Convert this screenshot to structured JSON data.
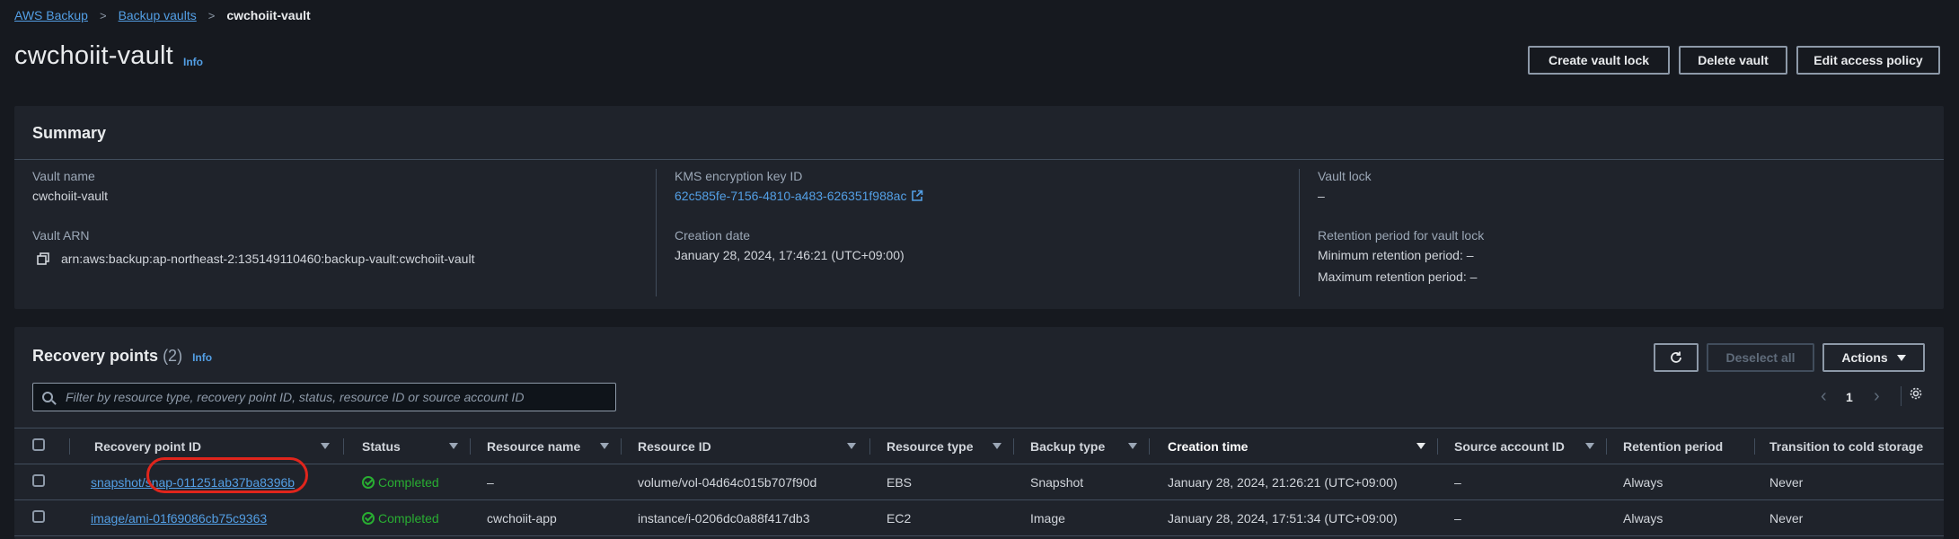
{
  "breadcrumb": [
    "AWS Backup",
    "Backup vaults",
    "cwchoiit-vault"
  ],
  "header": {
    "title": "cwchoiit-vault",
    "info": "Info",
    "buttons": {
      "create_lock": "Create vault lock",
      "delete": "Delete vault",
      "edit_policy": "Edit access policy"
    }
  },
  "summary": {
    "title": "Summary",
    "vault_name_label": "Vault name",
    "vault_name": "cwchoiit-vault",
    "vault_arn_label": "Vault ARN",
    "vault_arn": "arn:aws:backup:ap-northeast-2:135149110460:backup-vault:cwchoiit-vault",
    "kms_label": "KMS encryption key ID",
    "kms_value": "62c585fe-7156-4810-a483-626351f988ac",
    "creation_label": "Creation date",
    "creation_value": "January 28, 2024, 17:46:21 (UTC+09:00)",
    "lock_label": "Vault lock",
    "lock_value": "–",
    "retention_label": "Retention period for vault lock",
    "min_retention": "Minimum retention period: –",
    "max_retention": "Maximum retention period: –"
  },
  "recovery": {
    "title": "Recovery points",
    "count": "(2)",
    "info": "Info",
    "deselect": "Deselect all",
    "actions": "Actions",
    "search_placeholder": "Filter by resource type, recovery point ID, status, resource ID or source account ID",
    "page": "1",
    "columns": [
      "Recovery point ID",
      "Status",
      "Resource name",
      "Resource ID",
      "Resource type",
      "Backup type",
      "Creation time",
      "Source account ID",
      "Retention period",
      "Transition to cold storage"
    ],
    "rows": [
      {
        "id": "snapshot/snap-011251ab37ba8396b",
        "status": "Completed",
        "resource_name": "–",
        "resource_id": "volume/vol-04d64c015b707f90d",
        "resource_type": "EBS",
        "backup_type": "Snapshot",
        "creation_time": "January 28, 2024, 21:26:21 (UTC+09:00)",
        "source_account": "–",
        "retention": "Always",
        "cold": "Never"
      },
      {
        "id": "image/ami-01f69086cb75c9363",
        "status": "Completed",
        "resource_name": "cwchoiit-app",
        "resource_id": "instance/i-0206dc0a88f417db3",
        "resource_type": "EC2",
        "backup_type": "Image",
        "creation_time": "January 28, 2024, 17:51:34 (UTC+09:00)",
        "source_account": "–",
        "retention": "Always",
        "cold": "Never"
      }
    ]
  },
  "colors": {
    "background": "#16191f",
    "panel": "#1f232b",
    "link": "#539fe5",
    "success": "#29ad32",
    "highlight": "#e0251c"
  }
}
